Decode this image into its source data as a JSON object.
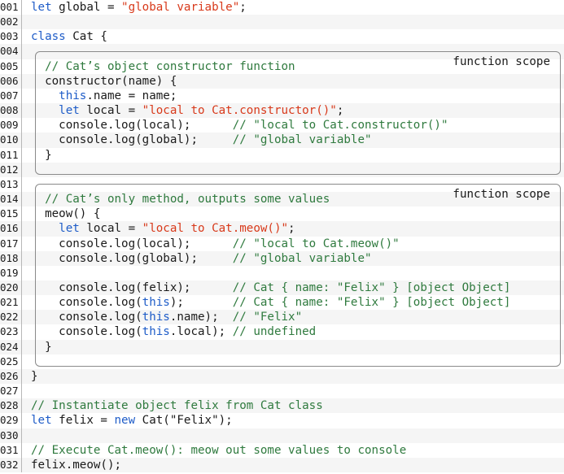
{
  "lines": [
    {
      "n": "001",
      "segs": [
        {
          "c": "kw",
          "t": "let"
        },
        {
          "c": "",
          "t": " global = "
        },
        {
          "c": "str",
          "t": "\"global variable\""
        },
        {
          "c": "",
          "t": ";"
        }
      ]
    },
    {
      "n": "002",
      "segs": []
    },
    {
      "n": "003",
      "segs": [
        {
          "c": "kw",
          "t": "class"
        },
        {
          "c": "",
          "t": " Cat {"
        }
      ]
    },
    {
      "n": "004",
      "segs": []
    },
    {
      "n": "005",
      "segs": [
        {
          "c": "",
          "t": "  "
        },
        {
          "c": "cmt",
          "t": "// Cat’s object constructor function"
        }
      ]
    },
    {
      "n": "006",
      "segs": [
        {
          "c": "",
          "t": "  constructor(name) {"
        }
      ]
    },
    {
      "n": "007",
      "segs": [
        {
          "c": "",
          "t": "    "
        },
        {
          "c": "kw",
          "t": "this"
        },
        {
          "c": "",
          "t": ".name = name;"
        }
      ]
    },
    {
      "n": "008",
      "segs": [
        {
          "c": "",
          "t": "    "
        },
        {
          "c": "kw",
          "t": "let"
        },
        {
          "c": "",
          "t": " local = "
        },
        {
          "c": "str",
          "t": "\"local to Cat.constructor()\""
        },
        {
          "c": "",
          "t": ";"
        }
      ]
    },
    {
      "n": "009",
      "segs": [
        {
          "c": "",
          "t": "    console.log(local);      "
        },
        {
          "c": "cmt",
          "t": "// \"local to Cat.constructor()\""
        }
      ]
    },
    {
      "n": "010",
      "segs": [
        {
          "c": "",
          "t": "    console.log(global);     "
        },
        {
          "c": "cmt",
          "t": "// \"global variable\""
        }
      ]
    },
    {
      "n": "011",
      "segs": [
        {
          "c": "",
          "t": "  }"
        }
      ]
    },
    {
      "n": "012",
      "segs": []
    },
    {
      "n": "013",
      "segs": []
    },
    {
      "n": "014",
      "segs": [
        {
          "c": "",
          "t": "  "
        },
        {
          "c": "cmt",
          "t": "// Cat’s only method, outputs some values"
        }
      ]
    },
    {
      "n": "015",
      "segs": [
        {
          "c": "",
          "t": "  meow() {"
        }
      ]
    },
    {
      "n": "016",
      "segs": [
        {
          "c": "",
          "t": "    "
        },
        {
          "c": "kw",
          "t": "let"
        },
        {
          "c": "",
          "t": " local = "
        },
        {
          "c": "str",
          "t": "\"local to Cat.meow()\""
        },
        {
          "c": "",
          "t": ";"
        }
      ]
    },
    {
      "n": "017",
      "segs": [
        {
          "c": "",
          "t": "    console.log(local);      "
        },
        {
          "c": "cmt",
          "t": "// \"local to Cat.meow()\""
        }
      ]
    },
    {
      "n": "018",
      "segs": [
        {
          "c": "",
          "t": "    console.log(global);     "
        },
        {
          "c": "cmt",
          "t": "// \"global variable\""
        }
      ]
    },
    {
      "n": "019",
      "segs": []
    },
    {
      "n": "020",
      "segs": [
        {
          "c": "",
          "t": "    console.log(felix);      "
        },
        {
          "c": "cmt",
          "t": "// Cat { name: \"Felix\" } [object Object]"
        }
      ]
    },
    {
      "n": "021",
      "segs": [
        {
          "c": "",
          "t": "    console.log("
        },
        {
          "c": "kw",
          "t": "this"
        },
        {
          "c": "",
          "t": ");       "
        },
        {
          "c": "cmt",
          "t": "// Cat { name: \"Felix\" } [object Object]"
        }
      ]
    },
    {
      "n": "022",
      "segs": [
        {
          "c": "",
          "t": "    console.log("
        },
        {
          "c": "kw",
          "t": "this"
        },
        {
          "c": "",
          "t": ".name);  "
        },
        {
          "c": "cmt",
          "t": "// \"Felix\""
        }
      ]
    },
    {
      "n": "023",
      "segs": [
        {
          "c": "",
          "t": "    console.log("
        },
        {
          "c": "kw",
          "t": "this"
        },
        {
          "c": "",
          "t": ".local); "
        },
        {
          "c": "cmt",
          "t": "// undefined"
        }
      ]
    },
    {
      "n": "024",
      "segs": [
        {
          "c": "",
          "t": "  }"
        }
      ]
    },
    {
      "n": "025",
      "segs": []
    },
    {
      "n": "026",
      "segs": [
        {
          "c": "",
          "t": "}"
        }
      ]
    },
    {
      "n": "027",
      "segs": []
    },
    {
      "n": "028",
      "segs": [
        {
          "c": "cmt",
          "t": "// Instantiate object felix from Cat class"
        }
      ]
    },
    {
      "n": "029",
      "segs": [
        {
          "c": "kw",
          "t": "let"
        },
        {
          "c": "",
          "t": " felix = "
        },
        {
          "c": "kw",
          "t": "new"
        },
        {
          "c": "",
          "t": " Cat(\"Felix\");"
        }
      ]
    },
    {
      "n": "030",
      "segs": []
    },
    {
      "n": "031",
      "segs": [
        {
          "c": "cmt",
          "t": "// Execute Cat.meow(): meow out some values to console"
        }
      ]
    },
    {
      "n": "032",
      "segs": [
        {
          "c": "",
          "t": "felix.meow();"
        }
      ]
    }
  ],
  "boxes": {
    "constructor_scope_label": "function scope",
    "meow_scope_label": "function scope"
  },
  "colors": {
    "keyword": "#1e5cc8",
    "string": "#d8391a",
    "comment": "#2f7a3e"
  }
}
